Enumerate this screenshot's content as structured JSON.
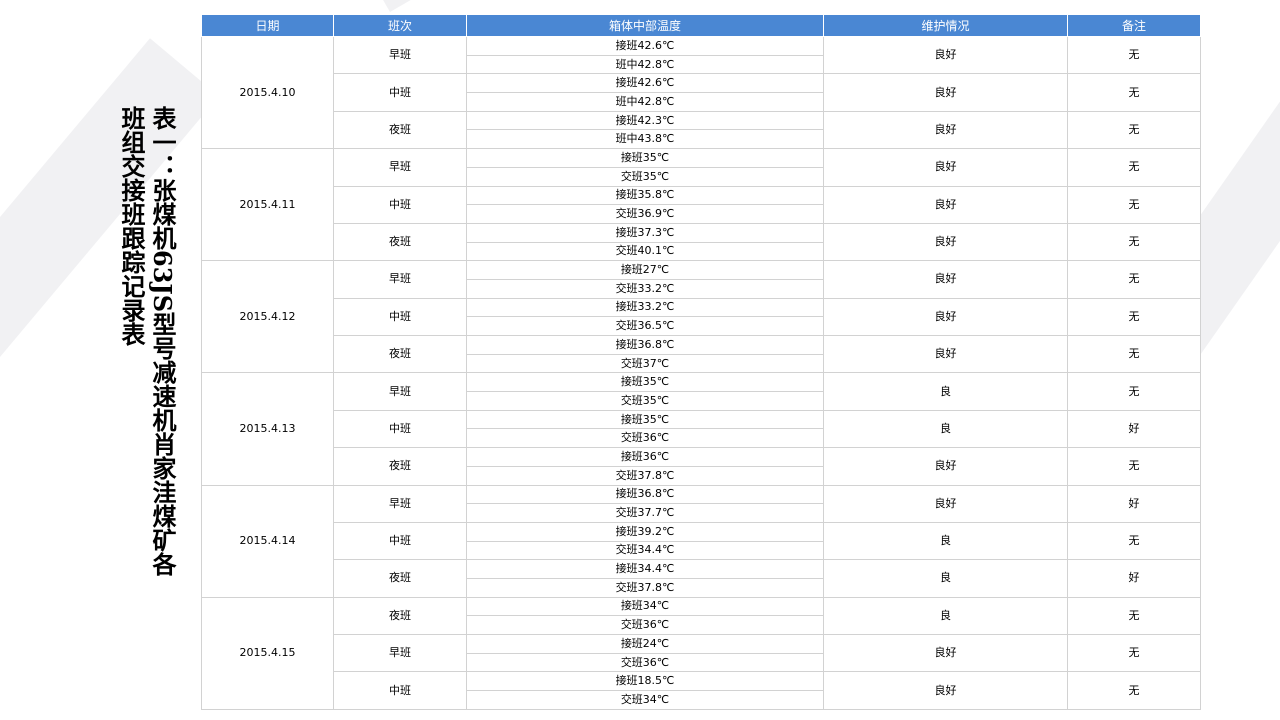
{
  "title": "表一：张煤机63JS型号减速机肖家洼煤矿各班组交接班跟踪记录表",
  "headers": [
    "日期",
    "班次",
    "箱体中部温度",
    "维护情况",
    "备注"
  ],
  "records": [
    {
      "date": "2015.4.10",
      "shifts": [
        {
          "shift": "早班",
          "temps": [
            "接班42.6℃",
            "班中42.8℃"
          ],
          "maintenance": "良好",
          "remarks": "无"
        },
        {
          "shift": "中班",
          "temps": [
            "接班42.6℃",
            "班中42.8℃"
          ],
          "maintenance": "良好",
          "remarks": "无"
        },
        {
          "shift": "夜班",
          "temps": [
            "接班42.3℃",
            "班中43.8℃"
          ],
          "maintenance": "良好",
          "remarks": "无"
        }
      ]
    },
    {
      "date": "2015.4.11",
      "shifts": [
        {
          "shift": "早班",
          "temps": [
            "接班35℃",
            "交班35℃"
          ],
          "maintenance": "良好",
          "remarks": "无"
        },
        {
          "shift": "中班",
          "temps": [
            "接班35.8℃",
            "交班36.9℃"
          ],
          "maintenance": "良好",
          "remarks": "无"
        },
        {
          "shift": "夜班",
          "temps": [
            "接班37.3℃",
            "交班40.1℃"
          ],
          "maintenance": "良好",
          "remarks": "无"
        }
      ]
    },
    {
      "date": "2015.4.12",
      "shifts": [
        {
          "shift": "早班",
          "temps": [
            "接班27℃",
            "交班33.2℃"
          ],
          "maintenance": "良好",
          "remarks": "无"
        },
        {
          "shift": "中班",
          "temps": [
            "接班33.2℃",
            "交班36.5℃"
          ],
          "maintenance": "良好",
          "remarks": "无"
        },
        {
          "shift": "夜班",
          "temps": [
            "接班36.8℃",
            "交班37℃"
          ],
          "maintenance": "良好",
          "remarks": "无"
        }
      ]
    },
    {
      "date": "2015.4.13",
      "shifts": [
        {
          "shift": "早班",
          "temps": [
            "接班35℃",
            "交班35℃"
          ],
          "maintenance": "良",
          "remarks": "无"
        },
        {
          "shift": "中班",
          "temps": [
            "接班35℃",
            "交班36℃"
          ],
          "maintenance": "良",
          "remarks": "好"
        },
        {
          "shift": "夜班",
          "temps": [
            "接班36℃",
            "交班37.8℃"
          ],
          "maintenance": "良好",
          "remarks": "无"
        }
      ]
    },
    {
      "date": "2015.4.14",
      "shifts": [
        {
          "shift": "早班",
          "temps": [
            "接班36.8℃",
            "交班37.7℃"
          ],
          "maintenance": "良好",
          "remarks": "好"
        },
        {
          "shift": "中班",
          "temps": [
            "接班39.2℃",
            "交班34.4℃"
          ],
          "maintenance": "良",
          "remarks": "无"
        },
        {
          "shift": "夜班",
          "temps": [
            "接班34.4℃",
            "交班37.8℃"
          ],
          "maintenance": "良",
          "remarks": "好"
        }
      ]
    },
    {
      "date": "2015.4.15",
      "shifts": [
        {
          "shift": "夜班",
          "temps": [
            "接班34℃",
            "交班36℃"
          ],
          "maintenance": "良",
          "remarks": "无"
        },
        {
          "shift": "早班",
          "temps": [
            "接班24℃",
            "交班36℃"
          ],
          "maintenance": "良好",
          "remarks": "无"
        },
        {
          "shift": "中班",
          "temps": [
            "接班18.5℃",
            "交班34℃"
          ],
          "maintenance": "良好",
          "remarks": "无"
        }
      ]
    }
  ]
}
